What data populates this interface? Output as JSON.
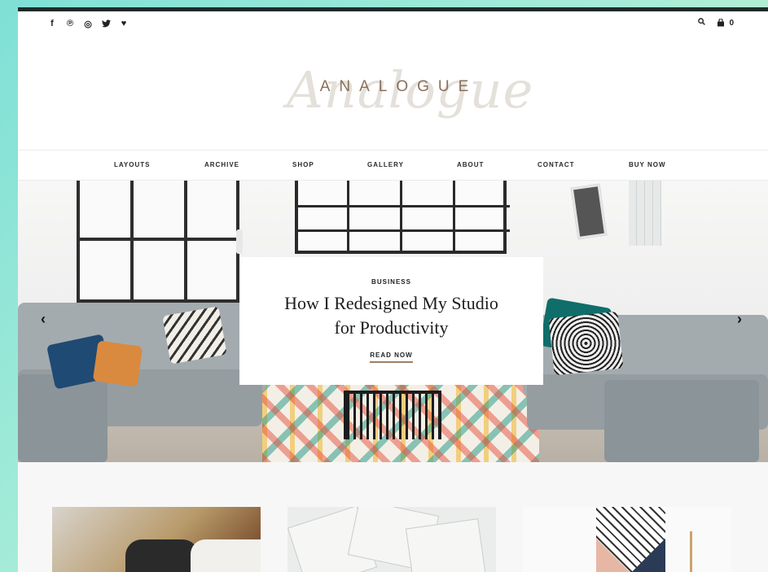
{
  "header": {
    "social_icons": [
      "facebook-icon",
      "pinterest-icon",
      "instagram-icon",
      "twitter-icon",
      "heart-icon"
    ],
    "social_glyphs": {
      "facebook": "f",
      "pinterest": "℗",
      "instagram": "◎",
      "twitter": "🐦",
      "heart": "♥"
    },
    "cart_count": "0",
    "logo_script": "Analogue",
    "logo_text": "ANALOGUE"
  },
  "nav": {
    "items": [
      "LAYOUTS",
      "ARCHIVE",
      "SHOP",
      "GALLERY",
      "ABOUT",
      "CONTACT",
      "BUY NOW"
    ]
  },
  "hero": {
    "category": "BUSINESS",
    "title_line1": "How I Redesigned My Studio",
    "title_line2": "for Productivity",
    "cta": "READ NOW",
    "prev_glyph": "‹",
    "next_glyph": "›"
  },
  "colors": {
    "accent": "#a07e64",
    "logo": "#8a6f5a",
    "text": "#222222"
  }
}
